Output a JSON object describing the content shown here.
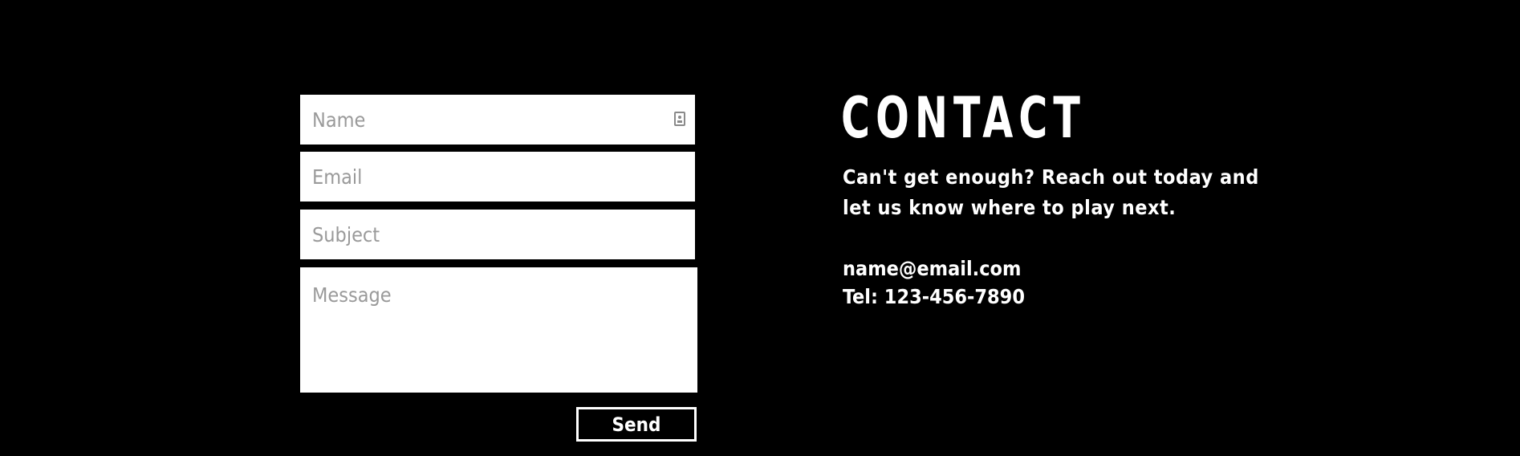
{
  "form": {
    "name_placeholder": "Name",
    "email_placeholder": "Email",
    "subject_placeholder": "Subject",
    "message_placeholder": "Message",
    "send_label": "Send",
    "name_icon": "contact-card-icon"
  },
  "contact": {
    "title": "CONTACT",
    "intro": "Can't get enough? Reach out today and let us know where to play next.",
    "email": "name@email.com",
    "tel": "Tel: 123-456-7890"
  },
  "colors": {
    "background": "#000000",
    "field_background": "#ffffff",
    "placeholder": "#9a9a9a",
    "text": "#ffffff"
  }
}
